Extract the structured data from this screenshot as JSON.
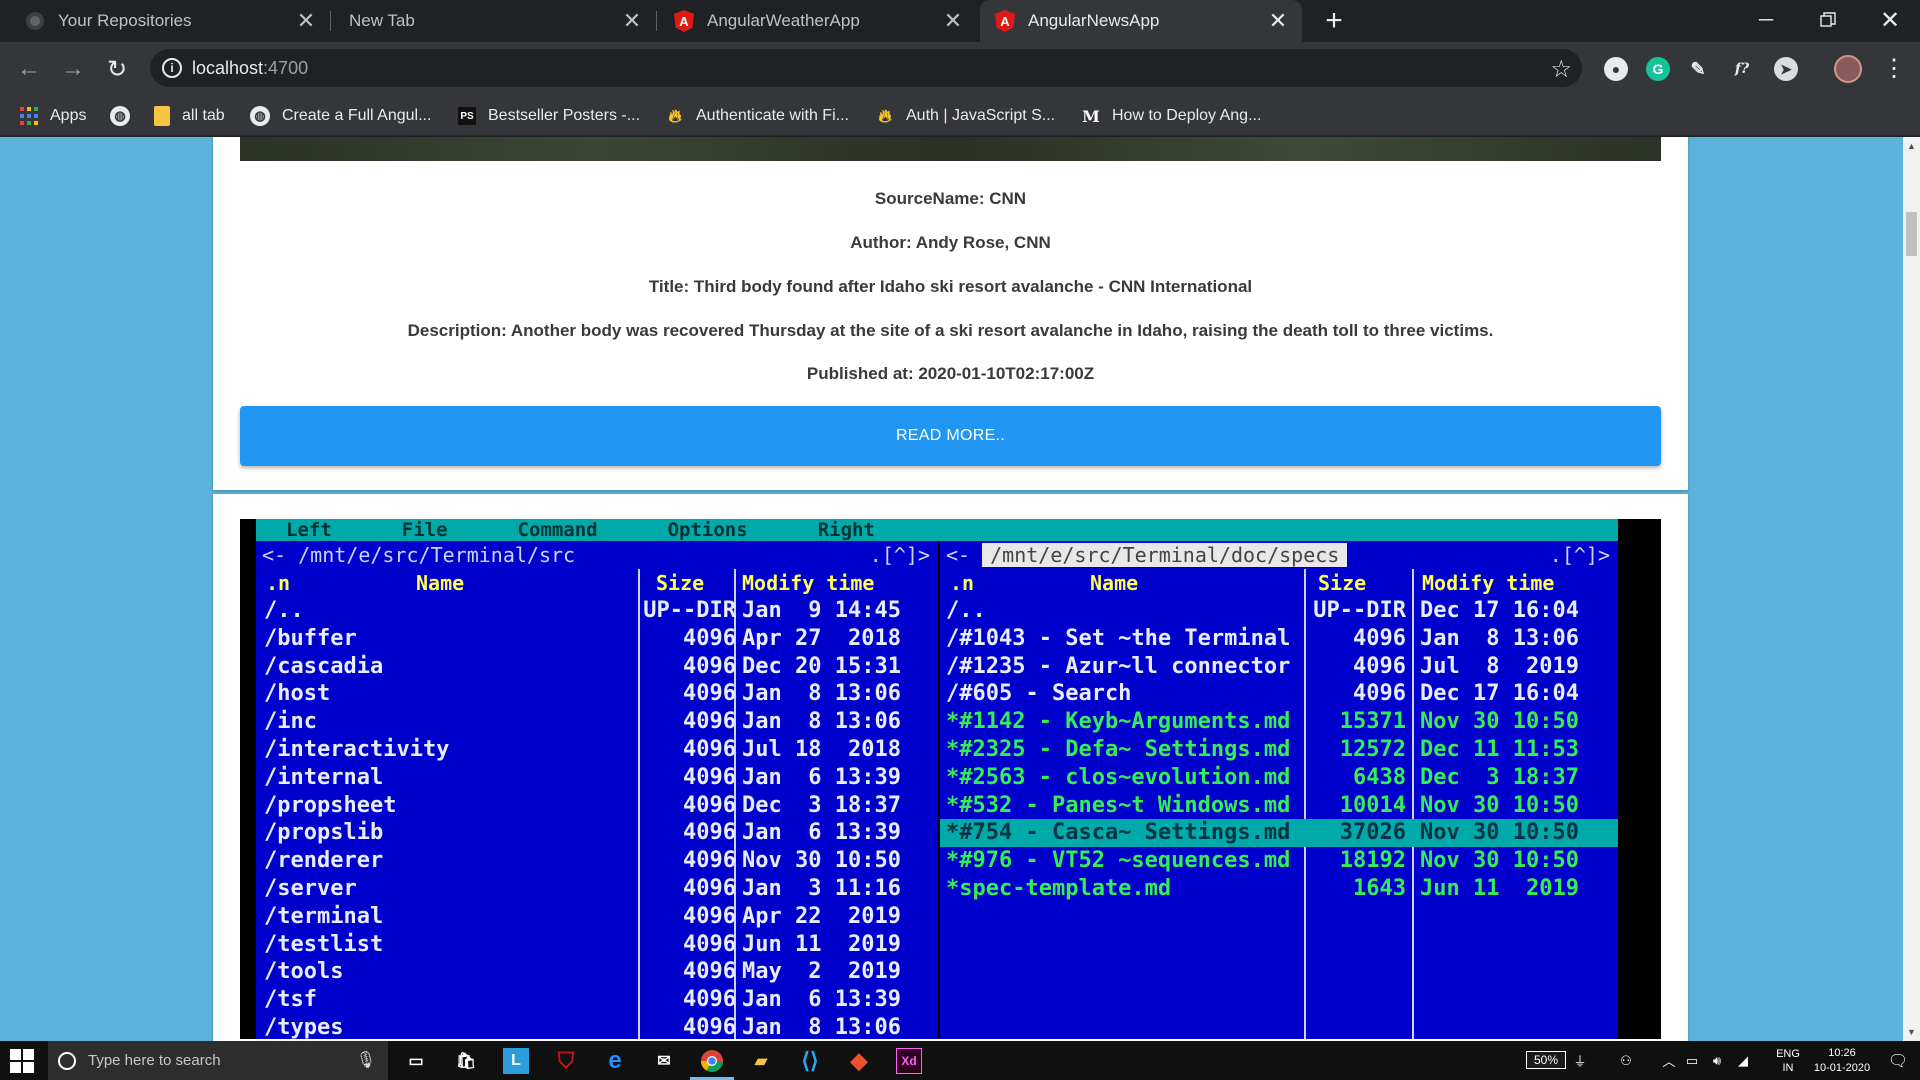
{
  "browser": {
    "tabs": [
      {
        "title": "Your Repositories",
        "icon": "github-icon",
        "active": false
      },
      {
        "title": "New Tab",
        "icon": "none",
        "active": false
      },
      {
        "title": "AngularWeatherApp",
        "icon": "angular-icon",
        "active": false
      },
      {
        "title": "AngularNewsApp",
        "icon": "angular-icon",
        "active": true
      }
    ],
    "url_host": "localhost",
    "url_port": ":4700",
    "bookmarks": [
      {
        "label": "Apps",
        "icon": "apps-grid-icon"
      },
      {
        "label": "",
        "icon": "globe-icon"
      },
      {
        "label": "all tab",
        "icon": "folder-icon"
      },
      {
        "label": "Create a Full Angul...",
        "icon": "globe-icon"
      },
      {
        "label": "Bestseller Posters -...",
        "icon": "ps-icon"
      },
      {
        "label": "Authenticate with Fi...",
        "icon": "firebase-icon"
      },
      {
        "label": "Auth | JavaScript S...",
        "icon": "firebase-icon"
      },
      {
        "label": "How to Deploy Ang...",
        "icon": "medium-icon"
      }
    ]
  },
  "article": {
    "source": "SourceName: CNN",
    "author": "Author: Andy Rose, CNN",
    "title": "Title: Third body found after Idaho ski resort avalanche - CNN International",
    "description": "Description: Another body was recovered Thursday at the site of a ski resort avalanche in Idaho, raising the death toll to three victims.",
    "published": "Published at: 2020-01-10T02:17:00Z",
    "read_more": "READ MORE.."
  },
  "terminal": {
    "menu": [
      "Left",
      "File",
      "Command",
      "Options",
      "Right"
    ],
    "left": {
      "path": "<- /mnt/e/src/Terminal/src",
      "corner": ".[^]>",
      "headers": {
        "n": ".n",
        "name": "Name",
        "size": "Size",
        "time": "Modify time"
      },
      "rows": [
        {
          "name": "/..",
          "size": "UP--DIR",
          "time": "Jan  9 14:45"
        },
        {
          "name": "/buffer",
          "size": "4096",
          "time": "Apr 27  2018"
        },
        {
          "name": "/cascadia",
          "size": "4096",
          "time": "Dec 20 15:31"
        },
        {
          "name": "/host",
          "size": "4096",
          "time": "Jan  8 13:06"
        },
        {
          "name": "/inc",
          "size": "4096",
          "time": "Jan  8 13:06"
        },
        {
          "name": "/interactivity",
          "size": "4096",
          "time": "Jul 18  2018"
        },
        {
          "name": "/internal",
          "size": "4096",
          "time": "Jan  6 13:39"
        },
        {
          "name": "/propsheet",
          "size": "4096",
          "time": "Dec  3 18:37"
        },
        {
          "name": "/propslib",
          "size": "4096",
          "time": "Jan  6 13:39"
        },
        {
          "name": "/renderer",
          "size": "4096",
          "time": "Nov 30 10:50"
        },
        {
          "name": "/server",
          "size": "4096",
          "time": "Jan  3 11:16"
        },
        {
          "name": "/terminal",
          "size": "4096",
          "time": "Apr 22  2019"
        },
        {
          "name": "/testlist",
          "size": "4096",
          "time": "Jun 11  2019"
        },
        {
          "name": "/tools",
          "size": "4096",
          "time": "May  2  2019"
        },
        {
          "name": "/tsf",
          "size": "4096",
          "time": "Jan  6 13:39"
        },
        {
          "name": "/types",
          "size": "4096",
          "time": "Jan  8 13:06"
        }
      ]
    },
    "right": {
      "path": "/mnt/e/src/Terminal/doc/specs",
      "prefix": "<-",
      "corner": ".[^]>",
      "headers": {
        "n": ".n",
        "name": "Name",
        "size": "Size",
        "time": "Modify time"
      },
      "rows": [
        {
          "name": "/..",
          "size": "UP--DIR",
          "time": "Dec 17 16:04",
          "style": "normal"
        },
        {
          "name": "/#1043 - Set ~the Terminal",
          "size": "4096",
          "time": "Jan  8 13:06",
          "style": "normal"
        },
        {
          "name": "/#1235 - Azur~ll connector",
          "size": "4096",
          "time": "Jul  8  2019",
          "style": "normal"
        },
        {
          "name": "/#605 - Search",
          "size": "4096",
          "time": "Dec 17 16:04",
          "style": "normal"
        },
        {
          "name": "*#1142 - Keyb~Arguments.md",
          "size": "15371",
          "time": "Nov 30 10:50",
          "style": "green"
        },
        {
          "name": "*#2325 - Defa~ Settings.md",
          "size": "12572",
          "time": "Dec 11 11:53",
          "style": "green"
        },
        {
          "name": "*#2563 - clos~evolution.md",
          "size": "6438",
          "time": "Dec  3 18:37",
          "style": "green"
        },
        {
          "name": "*#532 - Panes~t Windows.md",
          "size": "10014",
          "time": "Nov 30 10:50",
          "style": "green"
        },
        {
          "name": "*#754 - Casca~ Settings.md",
          "size": "37026",
          "time": "Nov 30 10:50",
          "style": "selected"
        },
        {
          "name": "*#976 - VT52 ~sequences.md",
          "size": "18192",
          "time": "Nov 30 10:50",
          "style": "green"
        },
        {
          "name": "*spec-template.md",
          "size": "1643",
          "time": "Jun 11  2019",
          "style": "green"
        }
      ]
    }
  },
  "taskbar": {
    "search_placeholder": "Type here to search",
    "battery": "50%",
    "lang_top": "ENG",
    "lang_bottom": "IN",
    "time": "10:26",
    "date": "10-01-2020"
  },
  "colors": {
    "page_bg": "#5cb2db",
    "button": "#2196f3",
    "terminal_blue": "#0000cc",
    "terminal_cyan": "#00aaaa"
  }
}
